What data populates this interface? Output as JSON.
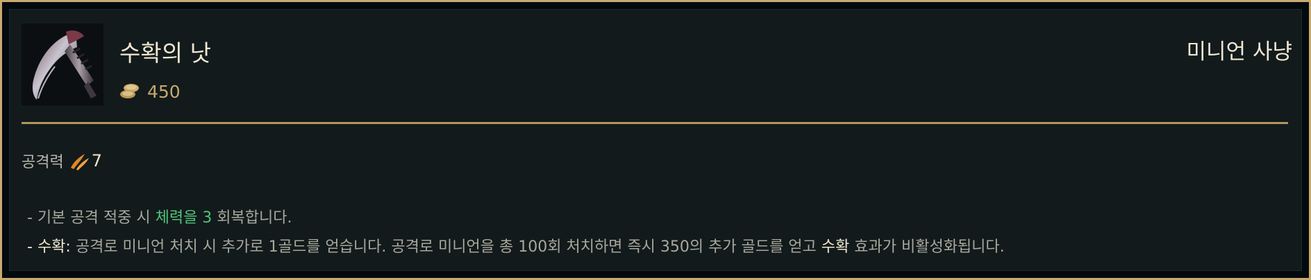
{
  "item": {
    "name": "수확의 낫",
    "cost": "450",
    "tag": "미니언 사냥",
    "icon": "scythe-item-icon"
  },
  "stat": {
    "label": "공격력",
    "value": "7",
    "icon": "attack-damage-icon"
  },
  "description": {
    "line1": {
      "prefix": "- 기본 공격 적중 시 ",
      "highlight": "체력을 3",
      "suffix": " 회복합니다."
    },
    "line2": {
      "prefix": "- ",
      "label": "수확:",
      "text": " 공격로 미니언 처치 시 추가로 1골드를 얻습니다. 공격로 미니언을 총 100회 처치하면 즉시 350의 추가 골드를 얻고 ",
      "keyword": "수확",
      "suffix": " 효과가 비활성화됩니다."
    }
  },
  "colors": {
    "border_gold": "#c8aa6e",
    "background": "#121a1b",
    "heal_green": "#51c47a",
    "gold_text": "#c8aa6e"
  }
}
